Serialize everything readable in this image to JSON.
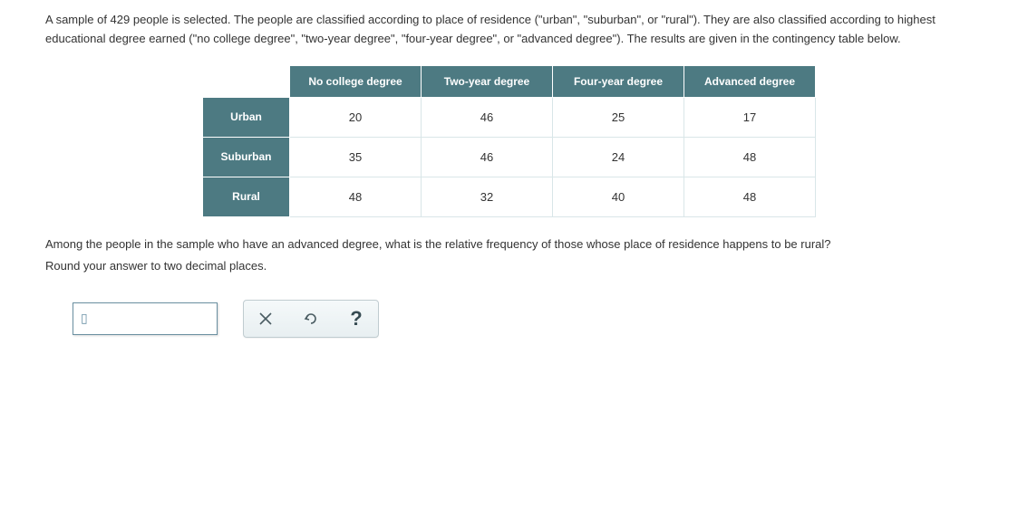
{
  "prompt": "A sample of 429 people is selected. The people are classified according to place of residence (\"urban\", \"suburban\", or \"rural\"). They are also classified according to highest educational degree earned (\"no college degree\", \"two-year degree\", \"four-year degree\", or \"advanced degree\"). The results are given in the contingency table below.",
  "table": {
    "columns": [
      "No college degree",
      "Two-year degree",
      "Four-year degree",
      "Advanced degree"
    ],
    "rows": [
      {
        "label": "Urban",
        "values": [
          "20",
          "46",
          "25",
          "17"
        ]
      },
      {
        "label": "Suburban",
        "values": [
          "35",
          "46",
          "24",
          "48"
        ]
      },
      {
        "label": "Rural",
        "values": [
          "48",
          "32",
          "40",
          "48"
        ]
      }
    ]
  },
  "question_line1": "Among the people in the sample who have an advanced degree, what is the relative frequency of those whose place of residence happens to be rural?",
  "question_line2": "Round your answer to two decimal places.",
  "answer_placeholder": "▯",
  "toolbar": {
    "clear": "clear",
    "undo": "undo",
    "help": "?"
  }
}
